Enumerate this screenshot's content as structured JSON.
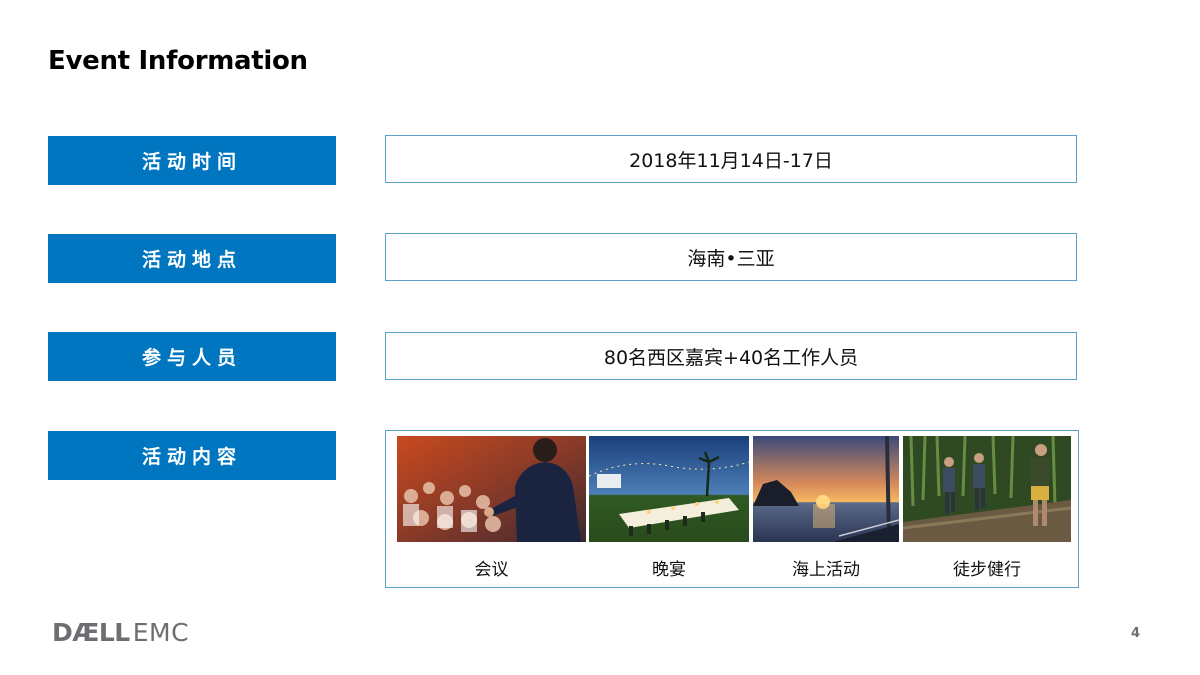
{
  "slide": {
    "title": "Event Information",
    "page_number": "4"
  },
  "rows": [
    {
      "label": "活动时间",
      "value": "2018年11月14日-17日"
    },
    {
      "label": "活动地点",
      "value": "海南•三亚"
    },
    {
      "label": "参与人员",
      "value": "80名西区嘉宾+40名工作人员"
    }
  ],
  "activities": {
    "label": "活动内容",
    "items": [
      {
        "caption": "会议"
      },
      {
        "caption": "晚宴"
      },
      {
        "caption": "海上活动"
      },
      {
        "caption": "徒步健行"
      }
    ]
  },
  "footer": {
    "logo": {
      "brand_part1": "DÆLL",
      "brand_part2": "EMC"
    }
  },
  "colors": {
    "label_bg": "#0076c0",
    "box_border": "#5aa0c8",
    "logo_gray": "#6d6e71"
  }
}
